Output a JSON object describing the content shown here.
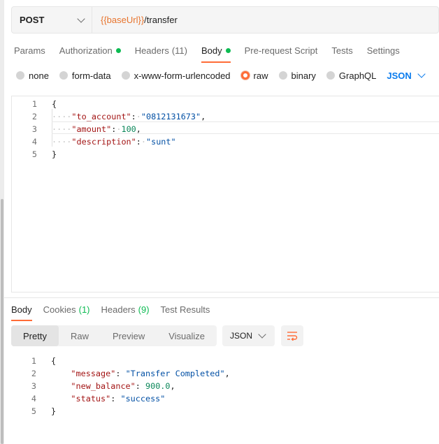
{
  "request": {
    "method": "POST",
    "url_var": "{{baseUrl}}",
    "url_path": "/transfer"
  },
  "request_tabs": [
    {
      "label": "Params"
    },
    {
      "label": "Authorization"
    },
    {
      "label": "Headers",
      "count": "(11)"
    },
    {
      "label": "Body"
    },
    {
      "label": "Pre-request Script"
    },
    {
      "label": "Tests"
    },
    {
      "label": "Settings"
    }
  ],
  "body_types": [
    "none",
    "form-data",
    "x-www-form-urlencoded",
    "raw",
    "binary",
    "GraphQL"
  ],
  "body_language": "JSON",
  "request_body": {
    "line_numbers": [
      "1",
      "2",
      "3",
      "4",
      "5"
    ],
    "open_brace": "{",
    "close_brace": "}",
    "fields": [
      {
        "key": "\"to_account\"",
        "value": "\"0812131673\"",
        "type": "str",
        "comma": ","
      },
      {
        "key": "\"amount\"",
        "value": "100",
        "type": "num",
        "comma": ","
      },
      {
        "key": "\"description\"",
        "value": "\"sunt\"",
        "type": "str",
        "comma": ""
      }
    ]
  },
  "response_tabs": [
    {
      "label": "Body"
    },
    {
      "label": "Cookies",
      "count": "(1)"
    },
    {
      "label": "Headers",
      "count": "(9)"
    },
    {
      "label": "Test Results"
    }
  ],
  "view_modes": [
    "Pretty",
    "Raw",
    "Preview",
    "Visualize"
  ],
  "response_format": "JSON",
  "response_body": {
    "line_numbers": [
      "1",
      "2",
      "3",
      "4",
      "5"
    ],
    "open_brace": "{",
    "close_brace": "}",
    "fields": [
      {
        "key": "\"message\"",
        "value": "\"Transfer Completed\"",
        "type": "str",
        "comma": ","
      },
      {
        "key": "\"new_balance\"",
        "value": "900.0",
        "type": "num",
        "comma": ","
      },
      {
        "key": "\"status\"",
        "value": "\"success\"",
        "type": "str",
        "comma": ""
      }
    ]
  },
  "colors": {
    "accent": "#ff6c37",
    "indicator": "#0cbb52",
    "link": "#097bed",
    "url_variable": "#e8742d"
  }
}
